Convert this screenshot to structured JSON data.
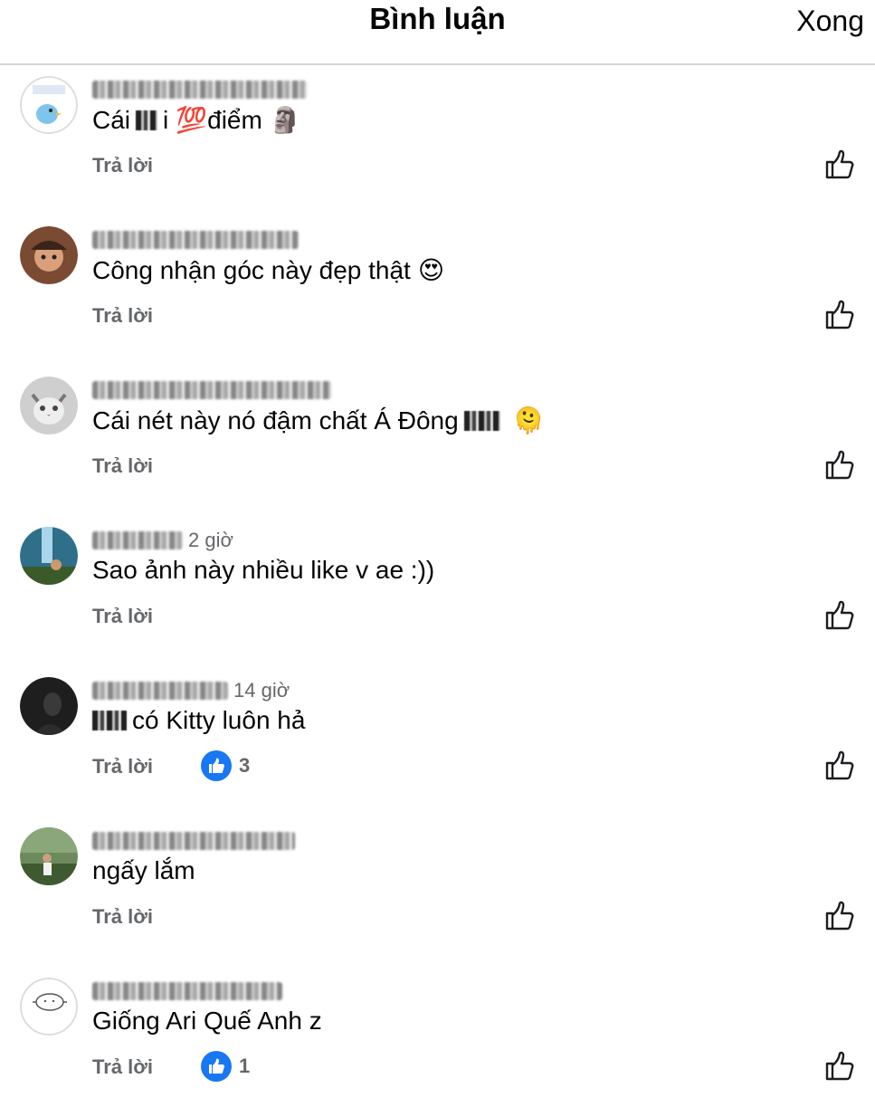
{
  "header": {
    "title": "Bình luận",
    "done_label": "Xong"
  },
  "comments": [
    {
      "time": "",
      "text": "Cái ",
      "text_after": "i",
      "emoji1": "💯",
      "text2": " điểm",
      "emoji2": "🗿",
      "reply_label": "Trả lời"
    },
    {
      "time": "",
      "text": "Công nhận góc này đẹp thật",
      "emoji1": "😍",
      "reply_label": "Trả lời"
    },
    {
      "time": "",
      "text": "Cái nét này nó đậm chất Á Đông",
      "emoji1": "🫠",
      "reply_label": "Trả lời"
    },
    {
      "time": "2 giờ",
      "text": "Sao ảnh này nhiều like v ae :))",
      "reply_label": "Trả lời"
    },
    {
      "time": "14 giờ",
      "text": "có Kitty luôn hả",
      "reply_label": "Trả lời",
      "like_count": "3"
    },
    {
      "time": "",
      "text": "ngấy lắm",
      "reply_label": "Trả lời"
    },
    {
      "time": "",
      "text": "Giống Ari Quế Anh z",
      "reply_label": "Trả lời",
      "like_count": "1"
    }
  ],
  "colors": {
    "like_blue": "#1877f2",
    "secondary_text": "#65676b",
    "divider": "#d6d6d6"
  },
  "icons": {
    "like_outline": "thumbs-up-outline-icon",
    "like_reaction": "like-reaction-icon"
  }
}
